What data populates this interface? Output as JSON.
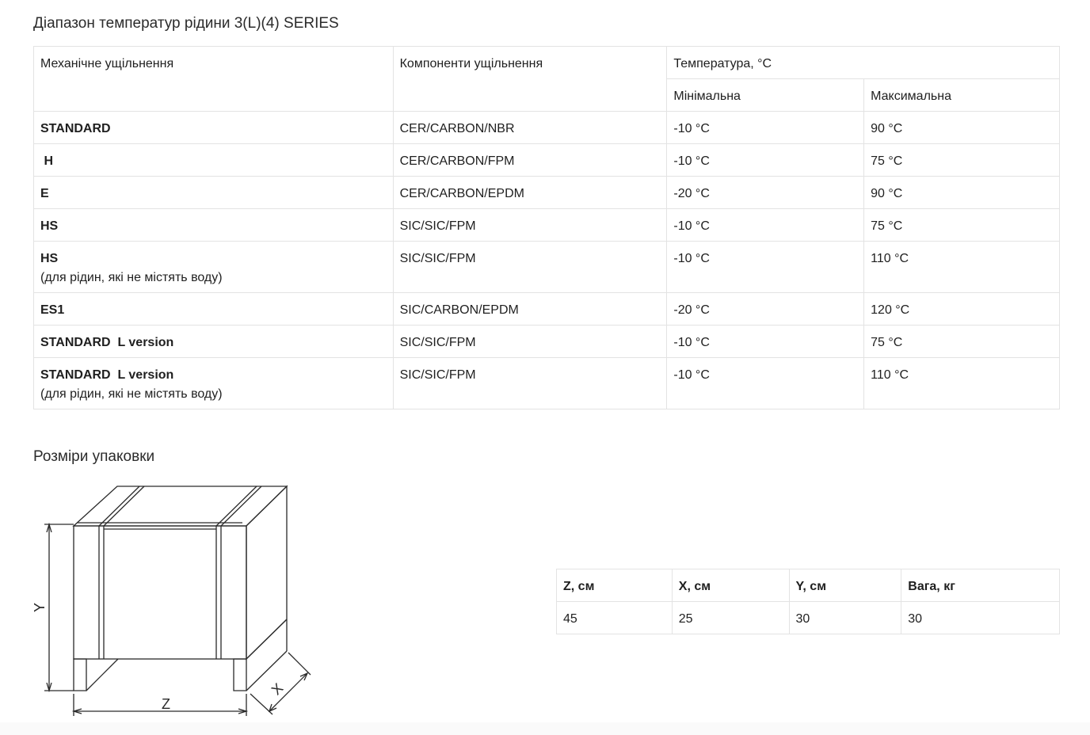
{
  "temperature_section": {
    "title": "Діапазон температур рідини 3(L)(4) SERIES",
    "headers": {
      "seal": "Механічне ущільнення",
      "components": "Компоненти ущільнення",
      "temperature": "Температура, °C",
      "min": "Мінімальна",
      "max": "Максимальна"
    },
    "rows": [
      {
        "seal": "STANDARD",
        "note": "",
        "components": "CER/CARBON/NBR",
        "min": "-10 °C",
        "max": "90 °C"
      },
      {
        "seal": " H",
        "note": "",
        "components": "CER/CARBON/FPM",
        "min": "-10 °C",
        "max": "75 °C"
      },
      {
        "seal": "E",
        "note": "",
        "components": "CER/CARBON/EPDM",
        "min": "-20 °C",
        "max": "90 °C"
      },
      {
        "seal": "HS",
        "note": "",
        "components": "SIC/SIC/FPM",
        "min": "-10 °C",
        "max": "75 °C"
      },
      {
        "seal": "HS",
        "note": "(для рідин, які не містять воду)",
        "components": "SIC/SIC/FPM",
        "min": "-10 °C",
        "max": "110 °C"
      },
      {
        "seal": "ES1",
        "note": "",
        "components": "SIC/CARBON/EPDM",
        "min": "-20 °C",
        "max": "120 °C"
      },
      {
        "seal": "STANDARD  L version",
        "note": "",
        "components": "SIC/SIC/FPM",
        "min": "-10 °C",
        "max": "75 °C"
      },
      {
        "seal": "STANDARD  L version",
        "note": "(для рідин, які не містять воду)",
        "components": "SIC/SIC/FPM",
        "min": "-10 °C",
        "max": "110 °C"
      }
    ]
  },
  "package_section": {
    "title": "Розміри упаковки",
    "diagram_labels": {
      "z": "Z",
      "x": "X",
      "y": "Y"
    },
    "headers": {
      "z": "Z, см",
      "x": "X, см",
      "y": "Y, см",
      "weight": "Вага, кг"
    },
    "values": {
      "z": "45",
      "x": "25",
      "y": "30",
      "weight": "30"
    }
  }
}
